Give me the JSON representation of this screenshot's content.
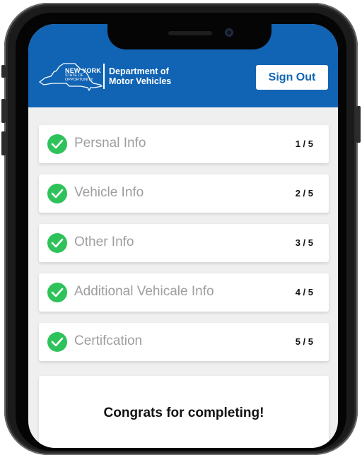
{
  "header": {
    "logo": {
      "state_line": "NEW YORK",
      "tagline_1": "STATE OF",
      "tagline_2": "OPPORTUNITY.",
      "dept_line_1": "Department of",
      "dept_line_2": "Motor Vehicles"
    },
    "sign_out_label": "Sign Out",
    "color": "#1164b4"
  },
  "steps": [
    {
      "label": "Persnal Info",
      "step": "1 / 5",
      "status": "complete"
    },
    {
      "label": "Vehicle Info",
      "step": "2 / 5",
      "status": "complete"
    },
    {
      "label": "Other Info",
      "step": "3 / 5",
      "status": "complete"
    },
    {
      "label": "Additional Vehicale Info",
      "step": "4 / 5",
      "status": "complete"
    },
    {
      "label": "Certifcation",
      "step": "5 / 5",
      "status": "complete"
    }
  ],
  "completion": {
    "message": "Congrats for completing!"
  },
  "colors": {
    "check": "#2ec35a",
    "label_text": "#9e9e9e"
  },
  "icons": {
    "check": "check-icon",
    "logo_map": "ny-state-map-icon"
  }
}
